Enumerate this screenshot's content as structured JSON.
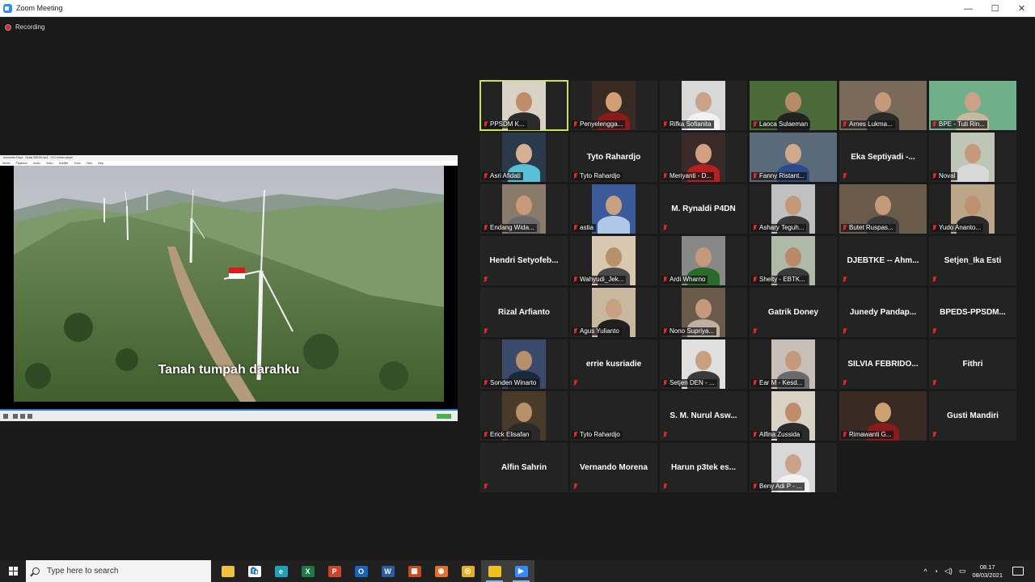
{
  "window": {
    "title": "Zoom Meeting",
    "minimize": "—",
    "maximize": "☐",
    "close": "✕"
  },
  "recording": {
    "label": "Recording"
  },
  "share": {
    "title": "Indonesia Raya - Sekar BSDM.mp4 - VLC media player",
    "menu": [
      "Media",
      "Playback",
      "Audio",
      "Video",
      "Subtitle",
      "Tools",
      "View",
      "Help"
    ],
    "caption": "Tanah tumpah darahku"
  },
  "participants": [
    {
      "name": "PPSDM K...",
      "video": true
    },
    {
      "name": "Penyelengga...",
      "video": true
    },
    {
      "name": "Rifka Sofianita",
      "video": true
    },
    {
      "name": "Laoca Sulaeman",
      "video": true
    },
    {
      "name": "Arnes Lukma...",
      "video": true
    },
    {
      "name": "BPE - Tuti Rin...",
      "video": true
    },
    {
      "name": "Asri Afidati",
      "video": true
    },
    {
      "name": "Tyto Rahardjo",
      "video": false,
      "display": "Tyto Rahardjo"
    },
    {
      "name": "Meriyanti - D...",
      "video": true
    },
    {
      "name": "Fanny Ristant...",
      "video": true
    },
    {
      "name": "",
      "video": false,
      "display": "Eka Septiyadi -..."
    },
    {
      "name": "Noval",
      "video": true
    },
    {
      "name": "Endang Wida...",
      "video": true
    },
    {
      "name": "astia",
      "video": true
    },
    {
      "name": "",
      "video": false,
      "display": "M. Rynaldi P4DN"
    },
    {
      "name": "Ashary Teguh...",
      "video": true
    },
    {
      "name": "Butet Ruspas...",
      "video": true
    },
    {
      "name": "Yudo Ananto...",
      "video": true
    },
    {
      "name": "",
      "video": false,
      "display": "Hendri Setyofeb..."
    },
    {
      "name": "Wahyudi_Jek...",
      "video": true
    },
    {
      "name": "Ardi Wharno",
      "video": true
    },
    {
      "name": "Shelty - EBTK...",
      "video": true
    },
    {
      "name": "",
      "video": false,
      "display": "DJEBTKE -- Ahm..."
    },
    {
      "name": "",
      "video": false,
      "display": "Setjen_Ika Esti"
    },
    {
      "name": "",
      "video": false,
      "display": "Rizal Arfianto"
    },
    {
      "name": "Agus Yulianto",
      "video": true
    },
    {
      "name": "Nono Supriya...",
      "video": true
    },
    {
      "name": "",
      "video": false,
      "display": "Gatrik Doney"
    },
    {
      "name": "",
      "video": false,
      "display": "Junedy Pandap..."
    },
    {
      "name": "",
      "video": false,
      "display": "BPEDS-PPSDM..."
    },
    {
      "name": "Sonden Winarto",
      "video": true
    },
    {
      "name": "",
      "video": false,
      "display": "errie kusriadie"
    },
    {
      "name": "Setjen DEN - ...",
      "video": true
    },
    {
      "name": "Ear M - Kesd...",
      "video": true
    },
    {
      "name": "",
      "video": false,
      "display": "SILVIA FEBRIDO..."
    },
    {
      "name": "",
      "video": false,
      "display": "Fithri"
    },
    {
      "name": "Erick Elisafan",
      "video": true
    },
    {
      "name": "Tyto Rahardjo",
      "video": false,
      "display": ""
    },
    {
      "name": "",
      "video": false,
      "display": "S. M. Nurul Asw..."
    },
    {
      "name": "Alfina Zussida",
      "video": true
    },
    {
      "name": "Rimawanti G...",
      "video": true
    },
    {
      "name": "",
      "video": false,
      "display": "Gusti Mandiri"
    },
    {
      "name": "",
      "video": false,
      "display": "Alfin Sahrin"
    },
    {
      "name": "",
      "video": false,
      "display": "Vernando Morena"
    },
    {
      "name": "",
      "video": false,
      "display": "Harun p3tek es..."
    },
    {
      "name": "Beny Adi P - ...",
      "video": true
    }
  ],
  "taskbar": {
    "search_placeholder": "Type here to search",
    "apps": [
      "file-explorer",
      "store",
      "edge",
      "excel",
      "powerpoint",
      "outlook",
      "word",
      "photos",
      "firefox",
      "chrome",
      "sticky-notes",
      "zoom"
    ],
    "time": "08.17",
    "date": "08/03/2021"
  }
}
